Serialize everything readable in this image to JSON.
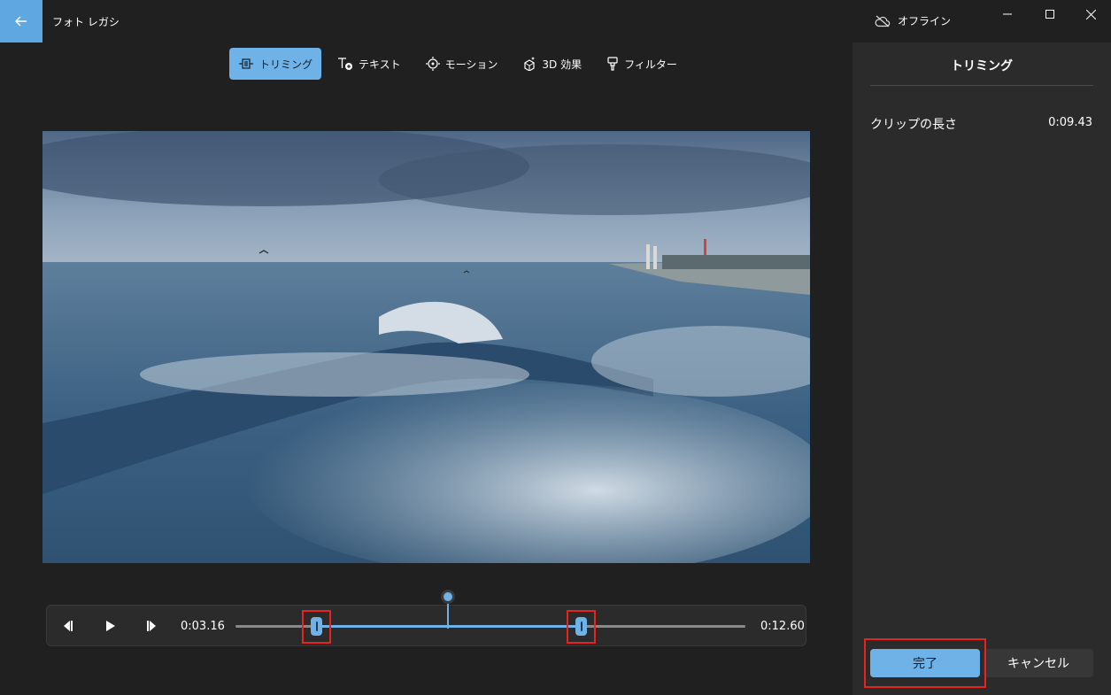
{
  "app": {
    "title": "フォト レガシ"
  },
  "status": {
    "offline_label": "オフライン"
  },
  "toolbar": {
    "tools": [
      {
        "label": "トリミング",
        "icon": "trim-icon",
        "active": true
      },
      {
        "label": "テキスト",
        "icon": "text-add-icon",
        "active": false
      },
      {
        "label": "モーション",
        "icon": "motion-icon",
        "active": false
      },
      {
        "label": "3D 効果",
        "icon": "3d-effects-icon",
        "active": false
      },
      {
        "label": "フィルター",
        "icon": "filter-icon",
        "active": false
      }
    ]
  },
  "timeline": {
    "start_time": "0:03.16",
    "end_time": "0:12.60",
    "trim_start_fraction": 0.158,
    "trim_end_fraction": 0.678,
    "playhead_fraction": 0.415
  },
  "panel": {
    "title": "トリミング",
    "clip_length_label": "クリップの長さ",
    "clip_length_value": "0:09.43",
    "done_label": "完了",
    "cancel_label": "キャンセル"
  },
  "colors": {
    "accent": "#6fb2e8",
    "highlight": "#e8231f",
    "background": "#202020",
    "panel": "#2b2b2b"
  }
}
